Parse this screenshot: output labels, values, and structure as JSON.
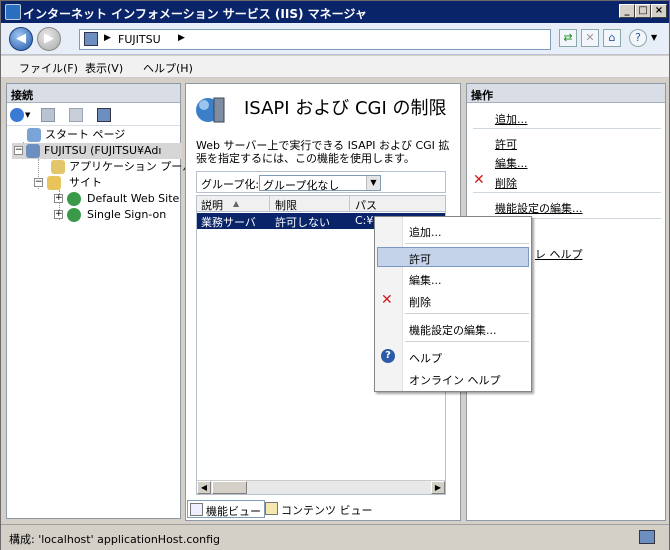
{
  "window": {
    "title": "インターネット インフォメーション サービス (IIS) マネージャ"
  },
  "address": {
    "crumb": "FUJITSU"
  },
  "menu": {
    "items": [
      "ファイル(F)",
      "表示(V)",
      "ヘルプ(H)"
    ]
  },
  "connections": {
    "header": "接続",
    "tree": {
      "start": "スタート ページ",
      "server": "FUJITSU (FUJITSU¥Adı",
      "apppools": "アプリケーション プール",
      "sites": "サイト",
      "site1": "Default Web Site",
      "site2": "Single Sign-on"
    }
  },
  "feature": {
    "title": "ISAPI および CGI の制限",
    "description": "Web サーバー上で実行できる ISAPI および CGI 拡張を指定するには、この機能を使用します。",
    "group_label": "グループ化:",
    "group_value": "グループ化なし",
    "columns": [
      "説明",
      "制限",
      "パス"
    ],
    "row": {
      "desc": "業務サーバ",
      "restriction": "許可しない",
      "path": "C:¥l"
    }
  },
  "view_tabs": {
    "features": "機能ビュー",
    "content": "コンテンツ ビュー"
  },
  "actions": {
    "header": "操作",
    "add": "追加...",
    "allow": "許可",
    "edit": "編集...",
    "delete": "削除",
    "edit_settings": "機能設定の編集...",
    "help_partial": "レ ヘルプ"
  },
  "context_menu": {
    "add": "追加...",
    "allow": "許可",
    "edit": "編集...",
    "delete": "削除",
    "edit_settings": "機能設定の編集...",
    "help": "ヘルプ",
    "online_help": "オンライン ヘルプ"
  },
  "status": {
    "text": "構成: 'localhost' applicationHost.config"
  },
  "colors": {
    "titlebar": "#0a246a",
    "selection": "#0a246a",
    "highlight": "#c5d3ea",
    "delete_red": "#d21a1a"
  }
}
